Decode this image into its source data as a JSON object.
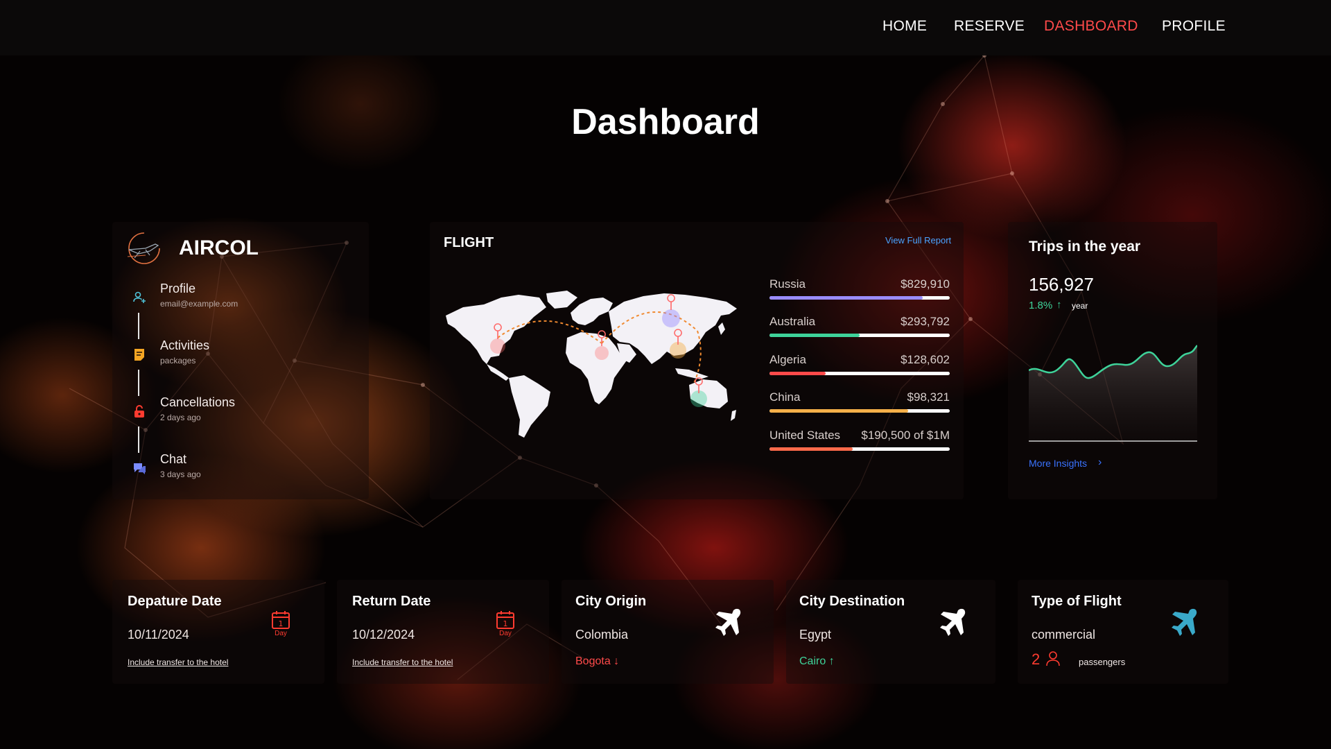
{
  "nav": {
    "items": [
      {
        "label": "HOME",
        "active": false
      },
      {
        "label": "RESERVE",
        "active": false
      },
      {
        "label": "DASHBOARD",
        "active": true
      },
      {
        "label": "PROFILE",
        "active": false
      }
    ],
    "active_color": "#ff4a4a"
  },
  "page": {
    "title": "Dashboard"
  },
  "sidebar": {
    "brand": "AIRCOL",
    "logo_icon": "airplane-logo-icon",
    "items": [
      {
        "title": "Profile",
        "subtitle": "email@example.com",
        "icon": "user-plus-icon",
        "color": "#4fc3d9"
      },
      {
        "title": "Activities",
        "subtitle": "packages",
        "icon": "note-icon",
        "color": "#f5a623"
      },
      {
        "title": "Cancellations",
        "subtitle": "2 days ago",
        "icon": "lock-icon",
        "color": "#ff3b30"
      },
      {
        "title": "Chat",
        "subtitle": "3 days ago",
        "icon": "chat-icon",
        "color": "#7b8cff"
      }
    ]
  },
  "flight": {
    "title": "FLIGHT",
    "view_report": "View Full Report",
    "countries": [
      {
        "name": "Russia",
        "value": "$829,910",
        "progress": 0.85,
        "color": "#9a8cff"
      },
      {
        "name": "Australia",
        "value": "$293,792",
        "progress": 0.5,
        "color": "#3ed39a"
      },
      {
        "name": "Algeria",
        "value": "$128,602",
        "progress": 0.31,
        "color": "#ff4a4a"
      },
      {
        "name": "China",
        "value": "$98,321",
        "progress": 0.77,
        "color": "#f5b049"
      },
      {
        "name": "United States",
        "value": "$190,500 of $1M",
        "progress": 0.46,
        "color": "#ff6a4a"
      }
    ]
  },
  "trips": {
    "title": "Trips in the year",
    "value": "156,927",
    "change": "1.8%",
    "period": "year",
    "more": "More Insights",
    "line_color": "#3ed39a"
  },
  "bottom": {
    "departure": {
      "title": "Depature Date",
      "value": "10/11/2024",
      "link": "Include transfer to the hotel",
      "cal_day": "1",
      "cal_label": "Day"
    },
    "return": {
      "title": "Return Date",
      "value": "10/12/2024",
      "link": "Include transfer to the hotel",
      "cal_day": "1",
      "cal_label": "Day"
    },
    "origin": {
      "title": "City Origin",
      "value": "Colombia",
      "city": "Bogota",
      "city_color": "#ff4a4a"
    },
    "destination": {
      "title": "City Destination",
      "value": "Egypt",
      "city": "Cairo",
      "city_color": "#3ed39a"
    },
    "type": {
      "title": "Type of Flight",
      "value": "commercial",
      "count": "2",
      "count_label": "passengers",
      "plane_color": "#3aa9c9"
    }
  }
}
